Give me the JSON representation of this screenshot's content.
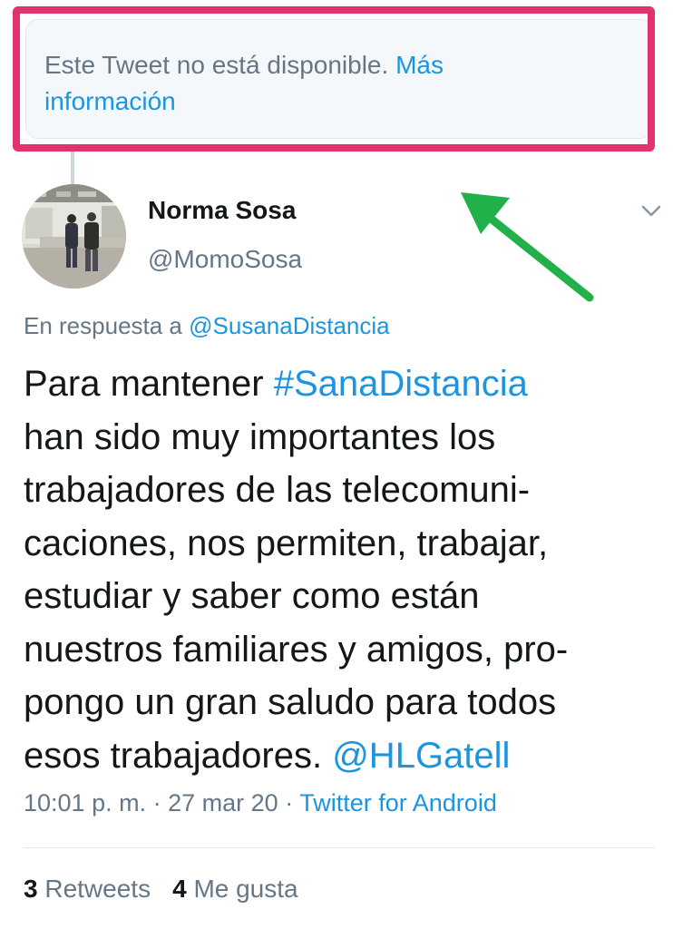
{
  "unavailable": {
    "message": "Este Tweet no está disponible.",
    "link_line1": "Más",
    "link_line2": "información"
  },
  "tweet": {
    "author_name": "Norma Sosa",
    "author_handle": "@MomoSosa",
    "reply_prefix": "En respuesta a",
    "reply_mention": "@SusanaDistancia",
    "body": {
      "l1_text": "Para mantener ",
      "l1_hashtag": "#SanaDistancia",
      "l2": "han sido muy importantes los",
      "l3": "trabajadores de las telecomuni-",
      "l4": "caciones, nos permiten, trabajar,",
      "l5": "estudiar  y saber como están",
      "l6": "nuestros familiares y amigos, pro-",
      "l7": "pongo un gran saludo para todos",
      "l8_text": "esos trabajadores. ",
      "l8_mention": "@HLGatell"
    },
    "time": "10:01 p. m.",
    "date": "27 mar 20",
    "separator": "·",
    "source": "Twitter for Android",
    "retweets_count": "3",
    "retweets_label": "Retweets",
    "likes_count": "4",
    "likes_label": "Me gusta"
  },
  "colors": {
    "highlight_frame": "#e0336f",
    "annotation_arrow": "#22b04b",
    "link_blue": "#1b95e0",
    "muted_gray": "#657786"
  },
  "icons": [
    "chevron-down-icon",
    "annotation-arrow-icon"
  ]
}
